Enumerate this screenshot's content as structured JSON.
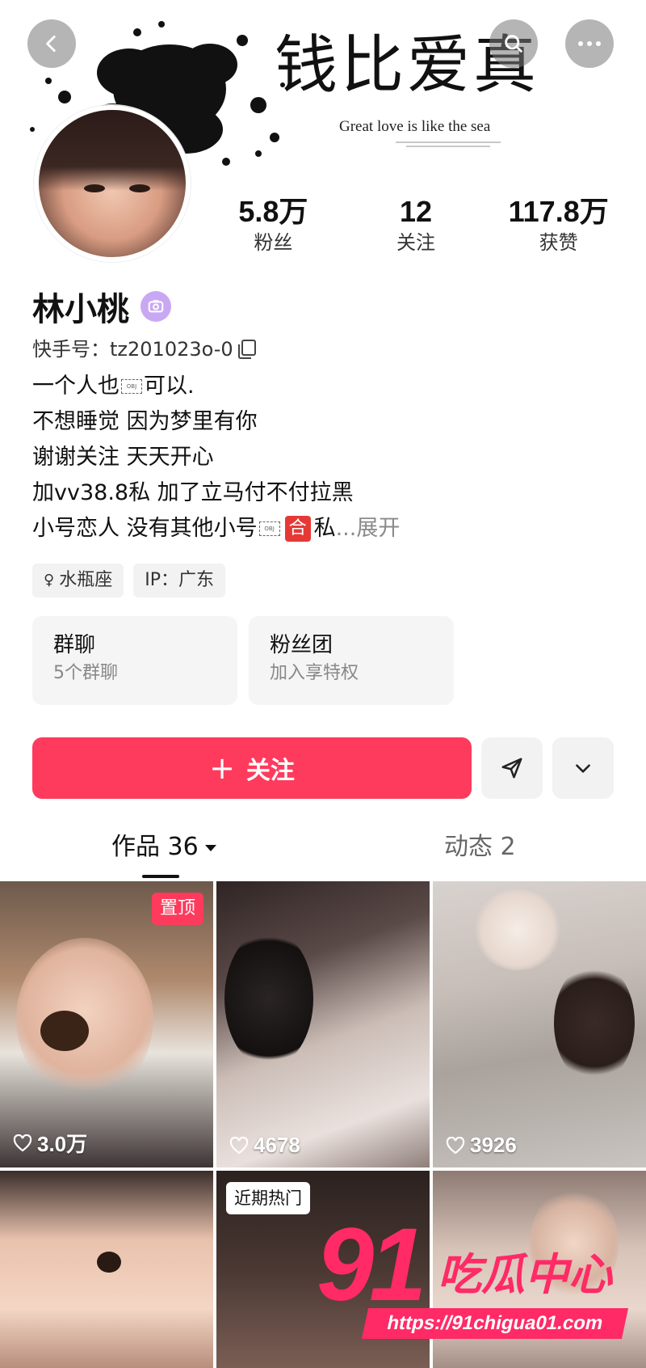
{
  "header": {
    "banner_title": "钱比爱真",
    "banner_subtitle": "Great love is like the sea"
  },
  "profile": {
    "name": "林小桃",
    "kwai_id": "快手号：tz201023o-0",
    "stats": [
      {
        "value": "5.8万",
        "label": "粉丝"
      },
      {
        "value": "12",
        "label": "关注"
      },
      {
        "value": "117.8万",
        "label": "获赞"
      }
    ],
    "bio": {
      "line1_a": "一个人也",
      "line1_b": "可以.",
      "line2": "不想睡觉 因为梦里有你",
      "line3": "谢谢关注 天天开心",
      "line4": "加vv38.8私 加了立马付不付拉黑",
      "line5_a": "小号恋人 没有其他小号",
      "line5_badge": "合",
      "line5_b": "私",
      "expand": "...展开"
    },
    "obj_placeholder": "OBJ",
    "tags": [
      {
        "icon": "female-symbol-icon",
        "label": "水瓶座"
      },
      {
        "label": "IP：广东"
      }
    ],
    "feature_boxes": [
      {
        "title": "群聊",
        "subtitle": "5个群聊"
      },
      {
        "title": "粉丝团",
        "subtitle": "加入享特权"
      }
    ]
  },
  "actions": {
    "follow_label": "关注",
    "follow_plus": "+"
  },
  "tabs": [
    {
      "label": "作品 36",
      "active": true
    },
    {
      "label": "动态 2",
      "active": false
    }
  ],
  "posts": [
    {
      "badge": "置顶",
      "likes": "3.0万"
    },
    {
      "likes": "4678"
    },
    {
      "likes": "3926"
    },
    {},
    {
      "badge": "近期热门"
    },
    {}
  ],
  "watermark": {
    "number": "91",
    "text": "吃瓜中心",
    "url": "https://91chigua01.com"
  },
  "colors": {
    "accent": "#fe3b5c",
    "watermark": "#ff2a66",
    "verify": "#c9a8f3"
  }
}
